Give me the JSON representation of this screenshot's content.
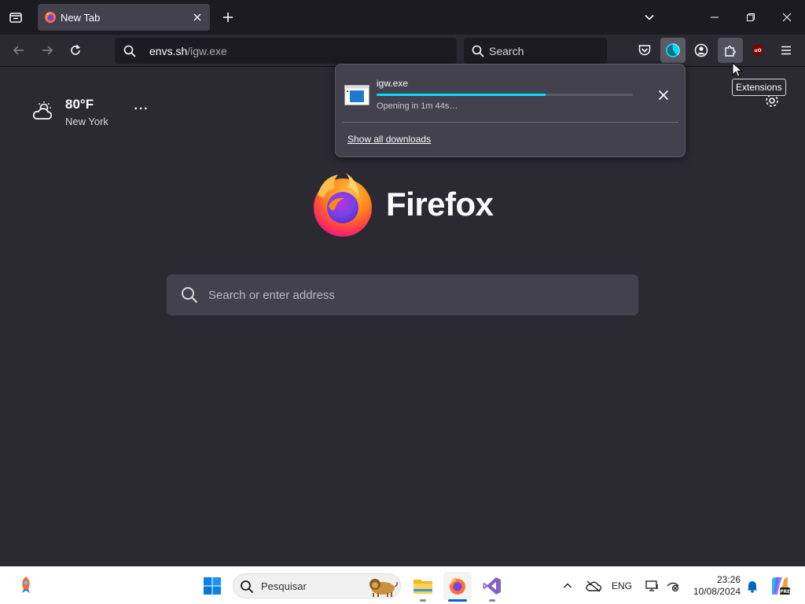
{
  "tabstrip": {
    "tab": {
      "title": "New Tab"
    }
  },
  "navbar": {
    "url": {
      "domain": "envs.sh",
      "path": "/igw.exe"
    },
    "search_placeholder": "Search"
  },
  "newtab": {
    "weather": {
      "temperature": "80°F",
      "city": "New York",
      "more": "···",
      "icon": "cloudy-sun-icon"
    },
    "brand": "Firefox",
    "search_placeholder": "Search or enter address"
  },
  "downloads_panel": {
    "item": {
      "filename": "igw.exe",
      "status": "Opening in 1m 44s…",
      "progress_fraction": 0.66
    },
    "show_all_label": "Show all downloads"
  },
  "tooltip": "Extensions",
  "taskbar": {
    "search_placeholder": "Pesquisar",
    "language": "ENG",
    "time": "23:26",
    "date": "10/08/2024"
  },
  "colors": {
    "chrome_bg": "#1c1b22",
    "page_bg": "#2b2a33",
    "accent_progress": "#00ddff",
    "taskbar_bg": "#ffffff"
  }
}
